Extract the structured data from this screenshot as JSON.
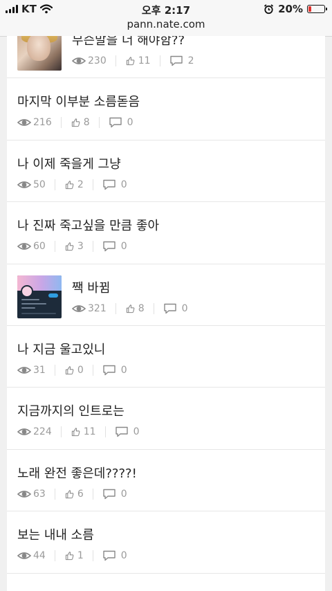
{
  "status_bar": {
    "carrier": "KT",
    "time": "오후 2:17",
    "battery_percent": "20%",
    "battery_level": 0.2,
    "url": "pann.nate.com"
  },
  "colors": {
    "battery_low": "#e3342f",
    "meta_text": "#9a9a9a",
    "divider": "#e6e6e6"
  },
  "posts": [
    {
      "title": "무슨말을 더 해야함??",
      "views": "230",
      "likes": "11",
      "comments": "2",
      "thumb": "photo"
    },
    {
      "title": "마지막 이부분 소름돋음",
      "views": "216",
      "likes": "8",
      "comments": "0"
    },
    {
      "title": "나 이제 죽을게 그냥",
      "views": "50",
      "likes": "2",
      "comments": "0"
    },
    {
      "title": "나 진짜 죽고싶을 만큼 좋아",
      "views": "60",
      "likes": "3",
      "comments": "0"
    },
    {
      "title": "짹 바뀜",
      "views": "321",
      "likes": "8",
      "comments": "0",
      "thumb": "twitter"
    },
    {
      "title": "나 지금 울고있니",
      "views": "31",
      "likes": "0",
      "comments": "0"
    },
    {
      "title": "지금까지의 인트로는",
      "views": "224",
      "likes": "11",
      "comments": "0"
    },
    {
      "title": "노래 완전 좋은데????!",
      "views": "63",
      "likes": "6",
      "comments": "0"
    },
    {
      "title": "보는 내내 소름",
      "views": "44",
      "likes": "1",
      "comments": "0"
    }
  ]
}
